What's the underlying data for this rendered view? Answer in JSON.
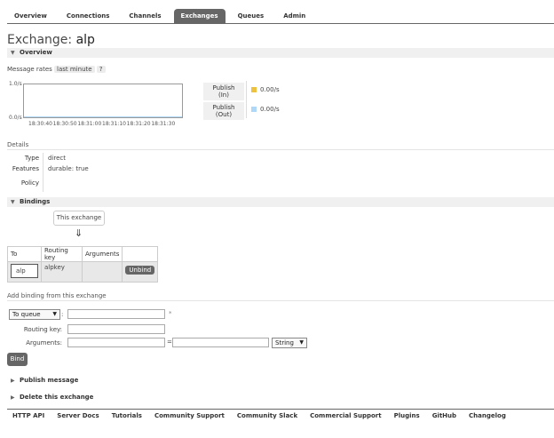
{
  "nav": {
    "tabs": [
      {
        "label": "Overview"
      },
      {
        "label": "Connections"
      },
      {
        "label": "Channels"
      },
      {
        "label": "Exchanges"
      },
      {
        "label": "Queues"
      },
      {
        "label": "Admin"
      }
    ],
    "active": "Exchanges"
  },
  "title": {
    "prefix": "Exchange:",
    "name": "alp"
  },
  "overview": {
    "header": "Overview",
    "message_rates_label": "Message rates",
    "range": "last minute",
    "help": "?",
    "y_top": "1.0/s",
    "y_bottom": "0.0/s",
    "x_ticks": [
      "18:30:40",
      "18:30:50",
      "18:31:00",
      "18:31:10",
      "18:31:20",
      "18:31:30"
    ],
    "legend": [
      {
        "label_line1": "Publish",
        "label_line2": "(In)",
        "value": "0.00/s",
        "color": "#edc240"
      },
      {
        "label_line1": "Publish",
        "label_line2": "(Out)",
        "value": "0.00/s",
        "color": "#afd8f8"
      }
    ]
  },
  "details": {
    "header": "Details",
    "type_key": "Type",
    "type_value": "direct",
    "features_key": "Features",
    "features_label": "durable:",
    "features_value": "true",
    "policy_key": "Policy",
    "policy_value": ""
  },
  "bindings": {
    "header": "Bindings",
    "this_exchange": "This exchange",
    "arrow": "⇓",
    "columns": [
      "To",
      "Routing key",
      "Arguments",
      ""
    ],
    "rows": [
      {
        "to": "alp",
        "routing_key": "alpkey",
        "arguments": "",
        "action": "Unbind"
      }
    ]
  },
  "add_binding": {
    "header": "Add binding from this exchange",
    "destination_type": "To queue",
    "destination_value": "",
    "required_mark": "*",
    "routing_key_label": "Routing key:",
    "routing_key_value": "",
    "arguments_label": "Arguments:",
    "arg_key": "",
    "equals": "=",
    "arg_value": "",
    "arg_type": "String",
    "bind_button": "Bind",
    "colon": ":"
  },
  "collapsed_sections": [
    {
      "label": "Publish message"
    },
    {
      "label": "Delete this exchange"
    }
  ],
  "footer": {
    "links": [
      "HTTP API",
      "Server Docs",
      "Tutorials",
      "Community Support",
      "Community Slack",
      "Commercial Support",
      "Plugins",
      "GitHub",
      "Changelog"
    ]
  },
  "chart_data": {
    "type": "line",
    "x": [
      "18:30:40",
      "18:30:50",
      "18:31:00",
      "18:31:10",
      "18:31:20",
      "18:31:30"
    ],
    "series": [
      {
        "name": "Publish (In)",
        "values": [
          0,
          0,
          0,
          0,
          0,
          0
        ]
      },
      {
        "name": "Publish (Out)",
        "values": [
          0,
          0,
          0,
          0,
          0,
          0
        ]
      }
    ],
    "ylim": [
      0,
      1
    ]
  }
}
